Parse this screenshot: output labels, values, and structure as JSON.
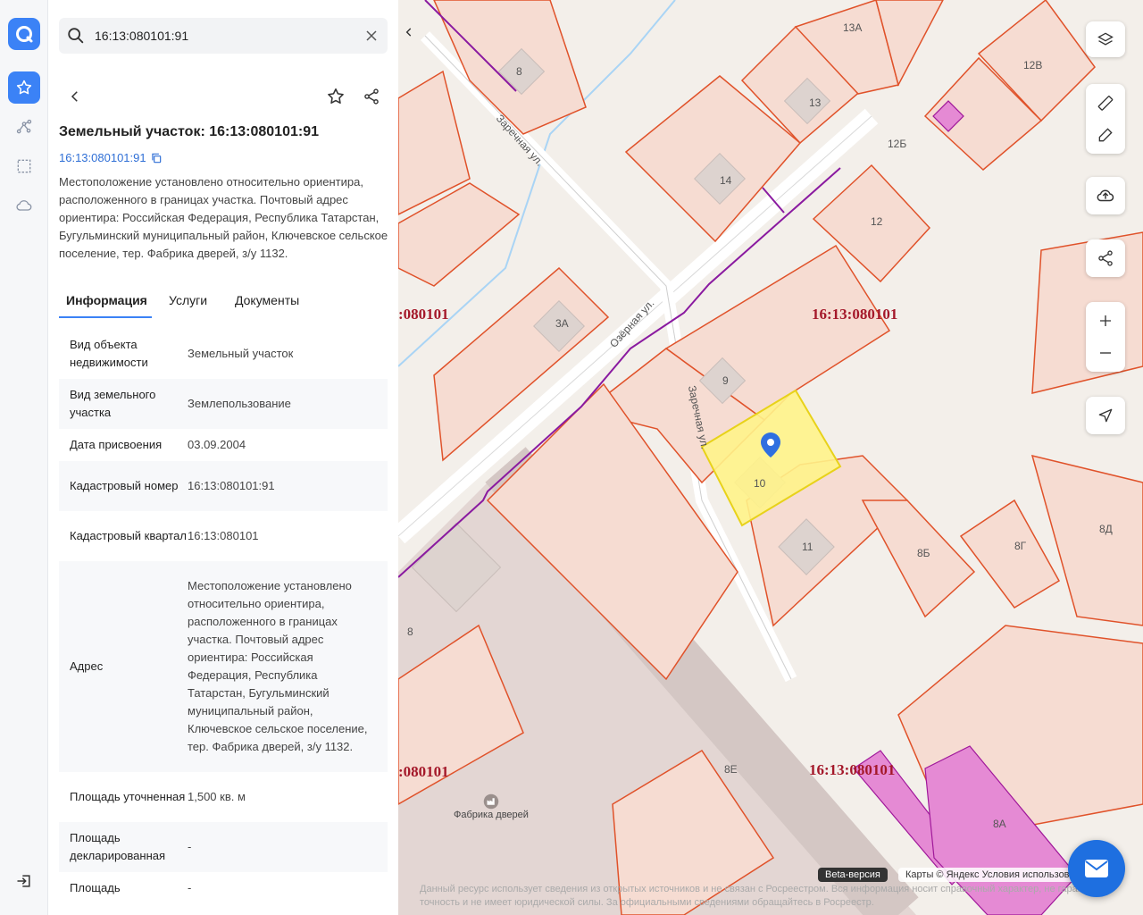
{
  "search": {
    "value": "16:13:080101:91"
  },
  "object": {
    "title": "Земельный участок: 16:13:080101:91",
    "cadastral_link": "16:13:080101:91",
    "description": "Местоположение установлено относительно ориентира, расположенного в границах участка. Почтовый адрес ориентира: Российская Федерация, Республика Татарстан, Бугульминский муниципальный район, Ключевское сельское поселение, тер. Фабрика дверей, з/у 1132."
  },
  "tabs": [
    {
      "label": "Информация",
      "active": true
    },
    {
      "label": "Услуги",
      "active": false
    },
    {
      "label": "Документы",
      "active": false
    }
  ],
  "info_rows": [
    {
      "key": "Вид объекта недвижимости",
      "value": "Земельный участок"
    },
    {
      "key": "Вид земельного участка",
      "value": "Землепользование"
    },
    {
      "key": "Дата присвоения",
      "value": "03.09.2004"
    },
    {
      "key": "Кадастровый номер",
      "value": "16:13:080101:91"
    },
    {
      "key": "Кадастровый квартал",
      "value": "16:13:080101"
    },
    {
      "key": "Адрес",
      "value": "Местоположение установлено относительно ориентира, расположенного в границах участка. Почтовый адрес ориентира: Российская Федерация, Республика Татарстан, Бугульминский муниципальный район, Ключевское сельское поселение, тер. Фабрика дверей, з/у 1132."
    },
    {
      "key": "Площадь уточненная",
      "value": "1,500 кв. м"
    },
    {
      "key": "Площадь декларированная",
      "value": "-"
    },
    {
      "key": "Площадь",
      "value": "-"
    }
  ],
  "map": {
    "quarters": [
      "16:13:080101",
      ":080101",
      "16:13:080101",
      ":080101"
    ],
    "streets": [
      "Заречная ул.",
      "Озёрная ул.",
      "Заречная ул."
    ],
    "houses": [
      "8",
      "13А",
      "12В",
      "13",
      "12Б",
      "14",
      "12",
      "3А",
      "9",
      "10",
      "11",
      "8Б",
      "8Г",
      "8Д",
      "8",
      "8Е",
      "8А"
    ],
    "poi": "Фабрика дверей",
    "beta": "Beta-версия",
    "attribution": "Карты © Яндекс   Условия использования",
    "disclaimer": "Данный ресурс использует сведения из открытых источников и не связан с Росреестром. Вся информация носит справочный характер, не гарантирует точность и не имеет юридической силы. За официальными сведениями обращайтесь в Росреестр."
  },
  "colors": {
    "accent": "#3b82f6",
    "parcel_border": "#e0522a",
    "selected_fill": "#fff38a",
    "quarter_label": "#a4182a"
  }
}
